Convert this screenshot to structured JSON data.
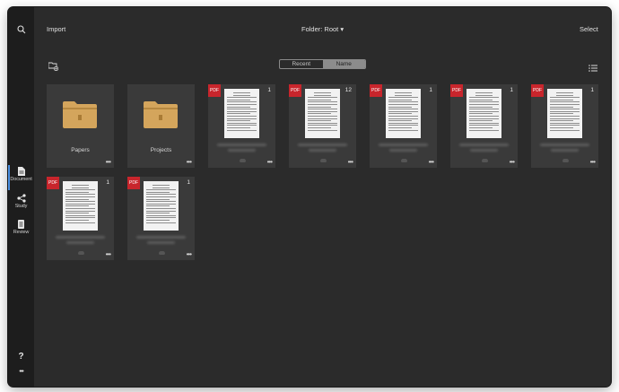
{
  "topbar": {
    "import_label": "Import",
    "folder_label": "Folder: Root ▾",
    "select_label": "Select"
  },
  "sort": {
    "options": [
      "Recent",
      "Name"
    ],
    "selected": "Name"
  },
  "sidebar": {
    "items": [
      {
        "label": "Document",
        "icon": "document-icon",
        "active": true
      },
      {
        "label": "Study",
        "icon": "share-nodes-icon",
        "active": false
      },
      {
        "label": "Review",
        "icon": "cards-icon",
        "active": false
      }
    ],
    "help_label": "?",
    "more_label": "•••"
  },
  "folders": [
    {
      "name": "Papers",
      "more": "•••"
    },
    {
      "name": "Projects",
      "more": "•••"
    }
  ],
  "documents": [
    {
      "badge": "PDF",
      "pages": "1",
      "more": "•••"
    },
    {
      "badge": "PDF",
      "pages": "12",
      "more": "•••"
    },
    {
      "badge": "PDF",
      "pages": "1",
      "more": "•••"
    },
    {
      "badge": "PDF",
      "pages": "1",
      "more": "•••"
    },
    {
      "badge": "PDF",
      "pages": "1",
      "more": "•••"
    },
    {
      "badge": "PDF",
      "pages": "1",
      "more": "•••"
    },
    {
      "badge": "PDF",
      "pages": "1",
      "more": "•••"
    }
  ],
  "colors": {
    "background": "#2b2b2b",
    "sidebar": "#1d1d1d",
    "tile": "#3a3a3a",
    "pdf_badge": "#c8252c",
    "folder": "#d4a55c",
    "active_indicator": "#4a90e2"
  }
}
